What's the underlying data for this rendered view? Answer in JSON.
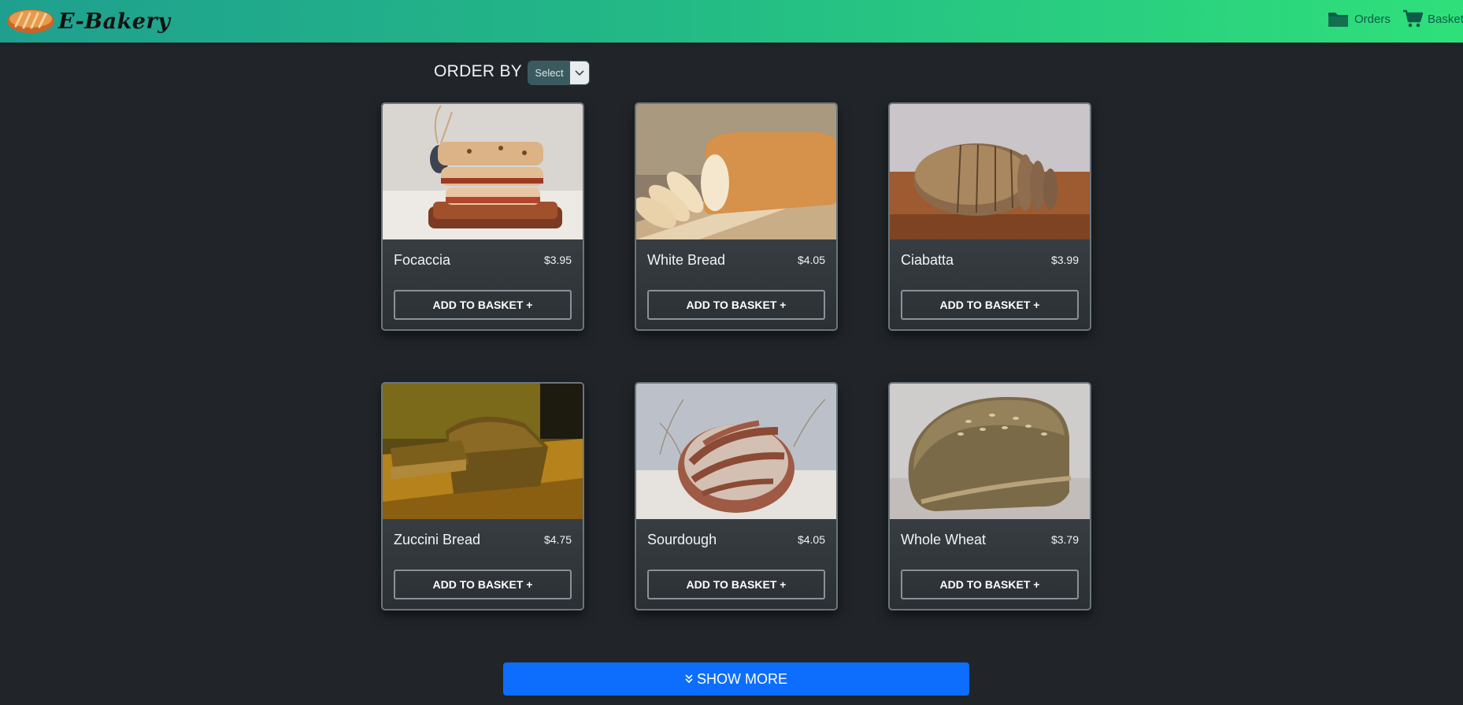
{
  "header": {
    "brand_name": "E-Bakery",
    "nav": {
      "orders_label": "Orders",
      "basket_label": "Basket"
    }
  },
  "sort": {
    "label": "ORDER BY",
    "selected": "Select"
  },
  "products": [
    {
      "name": "Focaccia",
      "price": "$3.95",
      "button": "ADD TO BASKET +"
    },
    {
      "name": "White Bread",
      "price": "$4.05",
      "button": "ADD TO BASKET +"
    },
    {
      "name": "Ciabatta",
      "price": "$3.99",
      "button": "ADD TO BASKET +"
    },
    {
      "name": "Zuccini Bread",
      "price": "$4.75",
      "button": "ADD TO BASKET +"
    },
    {
      "name": "Sourdough",
      "price": "$4.05",
      "button": "ADD TO BASKET +"
    },
    {
      "name": "Whole Wheat",
      "price": "$3.79",
      "button": "ADD TO BASKET +"
    }
  ],
  "show_more": "SHOW MORE",
  "colors": {
    "background": "#212529",
    "header_start": "#1fa08f",
    "header_end": "#2fe07a",
    "primary_button": "#0d6efd"
  }
}
